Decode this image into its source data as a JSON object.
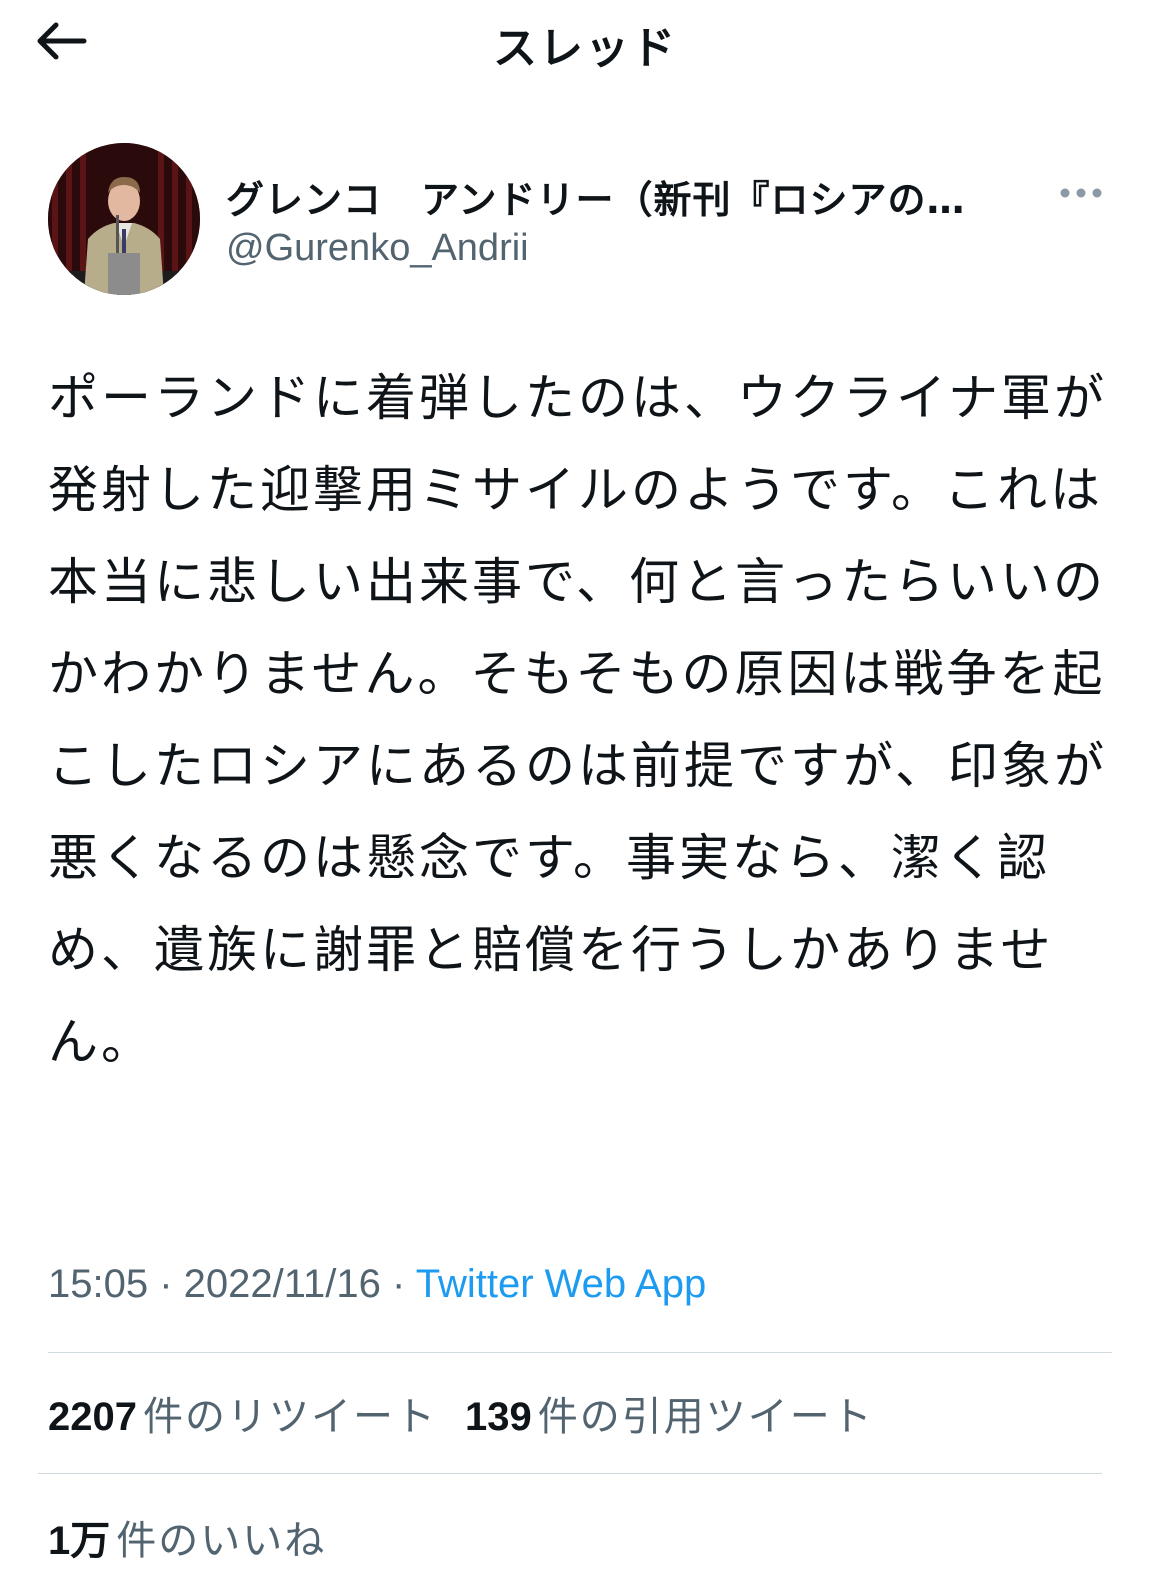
{
  "header": {
    "back_icon": "arrow-left-icon",
    "title": "スレッド"
  },
  "tweet": {
    "author": {
      "display_name": "グレンコ　アンドリー（新刊『ロシアの…",
      "handle": "@Gurenko_Andrii",
      "avatar": "avatar-photo"
    },
    "more_icon": "more-horizontal-icon",
    "text": "ポーランドに着弾したのは、ウクライナ軍が発射した迎撃用ミサイルのようです。これは本当に悲しい出来事で、何と言ったらいいのかわかりません。そもそもの原因は戦争を起こしたロシアにあるのは前提ですが、印象が悪くなるのは懸念です。事実なら、潔く認め、遺族に謝罪と賠償を行うしかありません。",
    "time": "15:05",
    "date": "2022/11/16",
    "separator": " · ",
    "source": "Twitter Web App"
  },
  "stats": {
    "retweets": {
      "count": "2207",
      "label": "件のリツイート"
    },
    "quotes": {
      "count": "139",
      "label": "件の引用ツイート"
    },
    "likes": {
      "count": "1万",
      "label": "件のいいね"
    }
  },
  "colors": {
    "text": "#0f1419",
    "secondary": "#536471",
    "link": "#1d9bf0",
    "divider": "#cfd9de"
  }
}
